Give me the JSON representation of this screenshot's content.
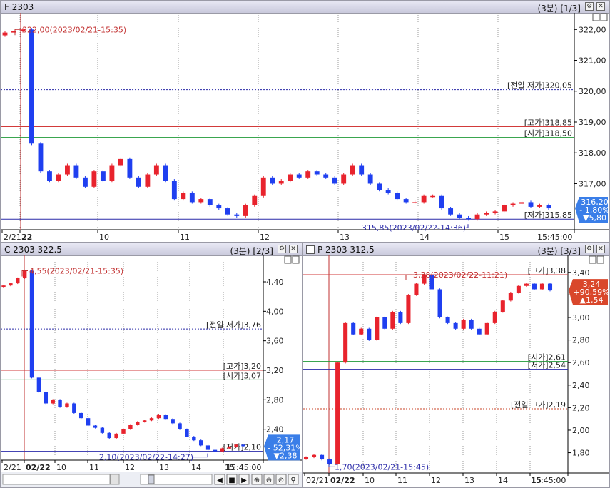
{
  "panels": [
    {
      "title": "F 2303",
      "period": "(3분)",
      "page": "[1/3]",
      "y_ticks": [
        "322,00",
        "321,00",
        "320,00",
        "319,00",
        "318,00",
        "317,00"
      ],
      "x_labels": [
        "2/21",
        "22",
        "10",
        "11",
        "12",
        "13",
        "14",
        "15",
        "15:45:00"
      ],
      "lines": {
        "prev_low": "[전일 저가]320,05",
        "high": "[고가]318,85",
        "open": "[시가]318,50",
        "low": "[저가]315,85"
      },
      "annotations": {
        "max": "322,00(2023/02/21-15:35)",
        "min": "315,85(2023/02/22-14:36)"
      },
      "badge": {
        "price": "316,20",
        "pct": "- 1,80%",
        "chg": "▼5,80",
        "color": "#3a7ee8"
      }
    },
    {
      "title": "C 2303 322.5",
      "period": "(3분)",
      "page": "[2/3]",
      "y_ticks": [
        "4,40",
        "4,00",
        "3,60",
        "3,20",
        "2,80",
        "2,40"
      ],
      "x_labels": [
        "2/21",
        "02/22",
        "10",
        "11",
        "12",
        "13",
        "14",
        "15",
        "15:45:00"
      ],
      "lines": {
        "prev_low": "[전일 저가]3,76",
        "high": "[고가]3,20",
        "open": "[시가]3,07",
        "low": "[저가]2,10"
      },
      "annotations": {
        "max": "4,55(2023/02/21-15:35)",
        "min": "2,10(2023/02/22-14:27)"
      },
      "badge": {
        "price": "2,17",
        "pct": "- 52,31%",
        "chg": "▼2,38",
        "color": "#3a7ee8"
      }
    },
    {
      "title": "P 2303 312.5",
      "period": "(3분)",
      "page": "[3/3]",
      "y_ticks": [
        "3,40",
        "3,20",
        "3,00",
        "2,80",
        "2,60",
        "2,40",
        "2,20",
        "2,00",
        "1,80"
      ],
      "x_labels": [
        "02/21",
        "02/22",
        "10",
        "11",
        "12",
        "13",
        "14",
        "15",
        "15:45:00"
      ],
      "lines": {
        "high": "[고가]3,38",
        "open": "[시가]2,61",
        "low": "[저가]2,54",
        "prev_high": "[전일 고가]2,19"
      },
      "annotations": {
        "max": "3,38(2023/02/22-11:21)",
        "min": "1,70(2023/02/21-15:45)"
      },
      "badge": {
        "price": "3,24",
        "pct": "+90,59%",
        "chg": "▲1,54",
        "color": "#d9472b"
      }
    }
  ],
  "colors": {
    "up": "#e8232d",
    "down": "#1f3ff0",
    "high_line": "#d23a3a",
    "open_line": "#1e9a36",
    "low_line": "#2a2aa8",
    "prev_line": "#2a2aa8",
    "prev_high_line": "#c8462a"
  },
  "chart_data": [
    {
      "type": "candlestick",
      "title": "F 2303",
      "ylim": [
        315.6,
        322.4
      ],
      "open": 318.5,
      "high": 318.85,
      "low": 315.85,
      "close": 316.2,
      "prev_low": 320.05,
      "close_path": [
        321.9,
        321.95,
        322.0,
        318.3,
        317.4,
        317.1,
        317.3,
        317.6,
        317.2,
        316.9,
        317.4,
        317.1,
        317.6,
        317.8,
        317.2,
        316.9,
        317.3,
        317.6,
        317.1,
        316.5,
        316.7,
        316.4,
        316.5,
        316.3,
        316.2,
        316.0,
        315.95,
        316.3,
        316.6,
        317.2,
        317.0,
        317.1,
        317.3,
        317.2,
        317.4,
        317.3,
        317.2,
        317.0,
        317.3,
        317.6,
        317.3,
        317.0,
        316.8,
        316.7,
        316.5,
        316.4,
        316.4,
        316.6,
        316.6,
        316.2,
        316.0,
        315.9,
        315.85,
        316.0,
        316.05,
        316.1,
        316.3,
        316.35,
        316.4,
        316.25,
        316.3,
        316.2
      ]
    },
    {
      "type": "candlestick",
      "title": "C 2303 322.5",
      "ylim": [
        2.0,
        4.7
      ],
      "open": 3.07,
      "high": 3.2,
      "low": 2.1,
      "close": 2.17,
      "prev_low": 3.76,
      "close_path": [
        4.35,
        4.38,
        4.45,
        4.55,
        3.1,
        2.9,
        2.75,
        2.8,
        2.7,
        2.75,
        2.62,
        2.55,
        2.45,
        2.42,
        2.35,
        2.28,
        2.34,
        2.4,
        2.46,
        2.5,
        2.52,
        2.55,
        2.6,
        2.54,
        2.48,
        2.4,
        2.3,
        2.25,
        2.18,
        2.12,
        2.1,
        2.14,
        2.16,
        2.19,
        2.17
      ]
    },
    {
      "type": "candlestick",
      "title": "P 2303 312.5",
      "ylim": [
        1.62,
        3.5
      ],
      "open": 2.61,
      "high": 3.38,
      "low": 2.54,
      "close": 3.24,
      "prev_high": 2.19,
      "close_path": [
        1.76,
        1.78,
        1.74,
        1.7,
        2.6,
        2.95,
        2.85,
        2.9,
        2.8,
        3.0,
        2.9,
        3.05,
        2.95,
        3.2,
        3.3,
        3.38,
        3.25,
        3.0,
        2.95,
        2.9,
        2.98,
        2.9,
        2.85,
        2.95,
        3.05,
        3.15,
        3.22,
        3.28,
        3.3,
        3.25,
        3.3,
        3.24
      ]
    }
  ]
}
